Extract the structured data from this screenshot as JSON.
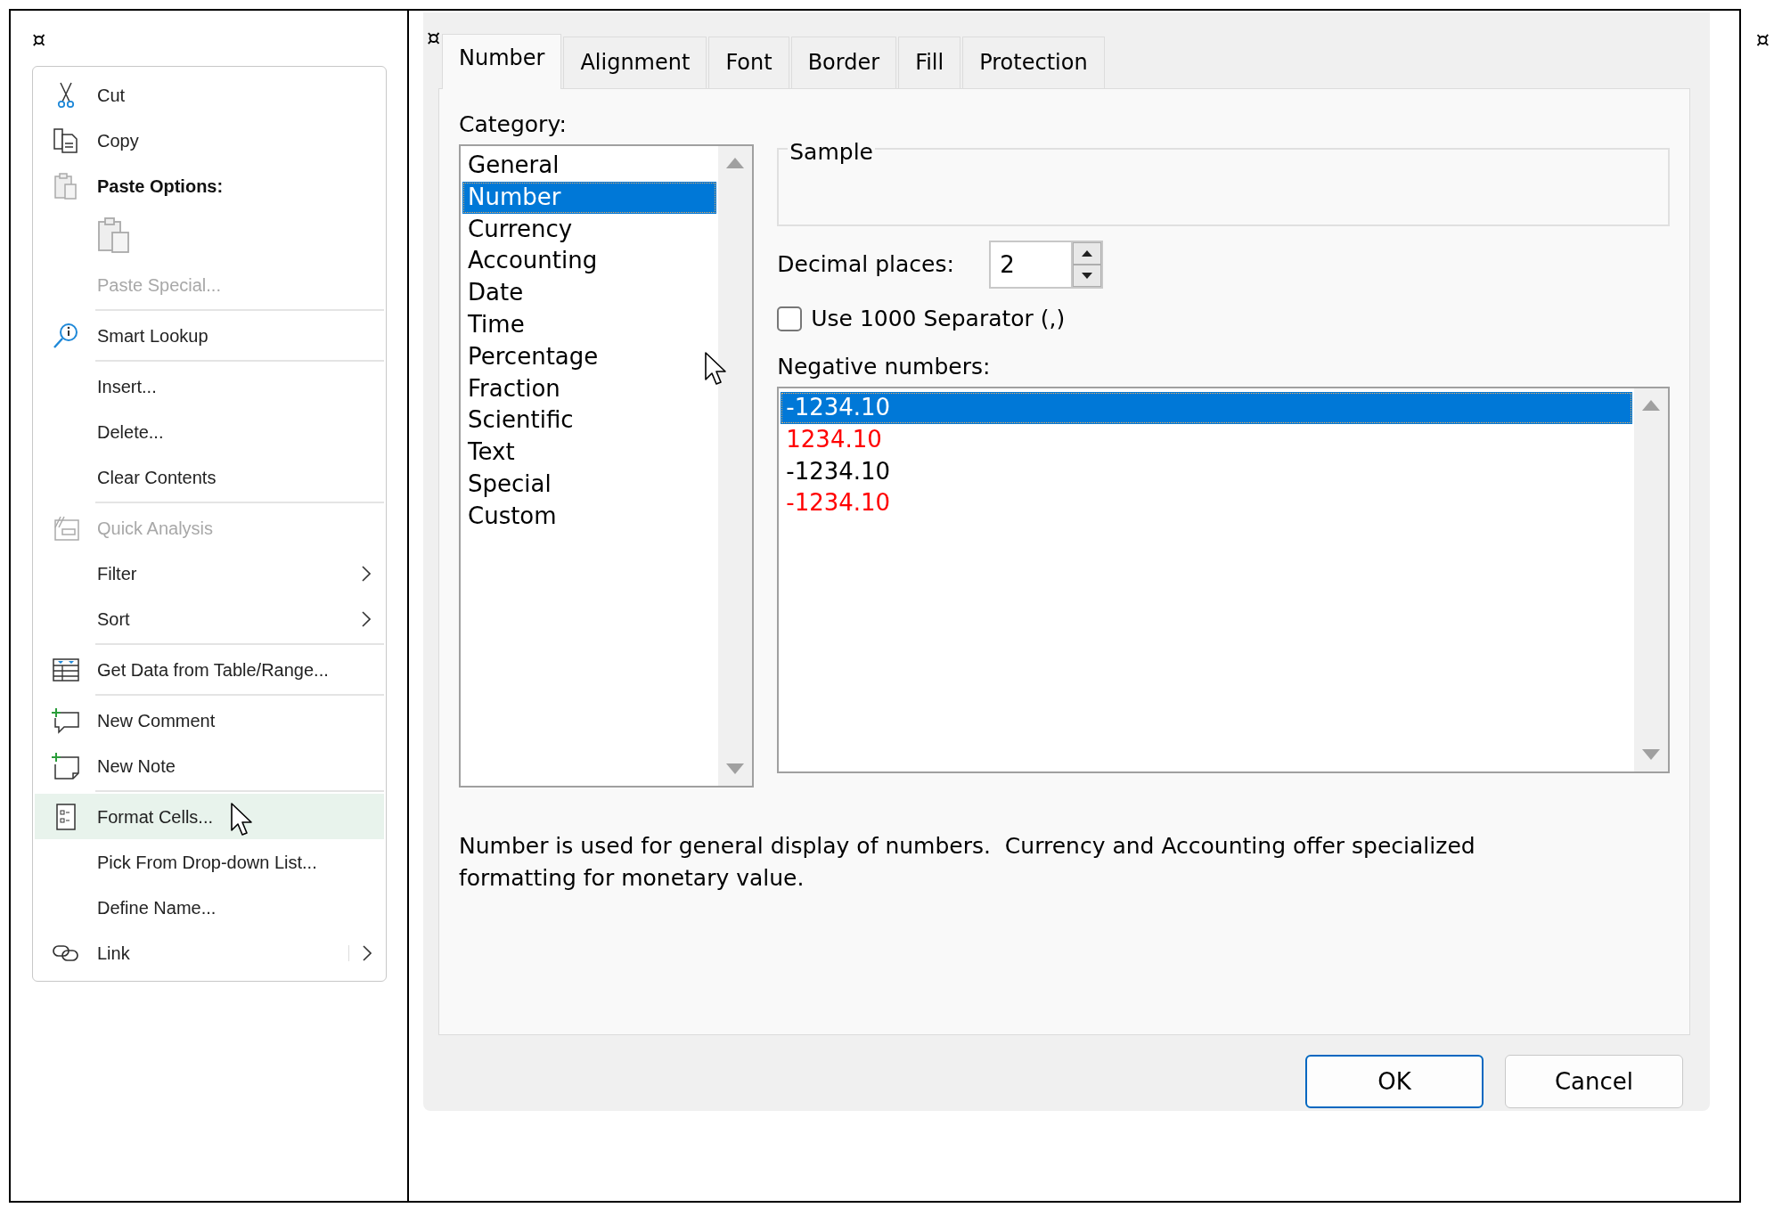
{
  "corner_marks": [
    "¤",
    "¤",
    "¤"
  ],
  "context_menu": {
    "items": [
      {
        "kind": "item",
        "label": "Cut",
        "disabled": false,
        "hovered": false,
        "submenu": false
      },
      {
        "kind": "item",
        "label": "Copy",
        "disabled": false,
        "hovered": false,
        "submenu": false
      },
      {
        "kind": "heading",
        "label": "Paste Options:",
        "disabled": false,
        "hovered": false,
        "submenu": false
      },
      {
        "kind": "paste-icons",
        "disabled": true
      },
      {
        "kind": "item",
        "label": "Paste Special...",
        "disabled": true,
        "hovered": false,
        "submenu": false
      },
      {
        "kind": "separator"
      },
      {
        "kind": "item",
        "label": "Smart Lookup",
        "disabled": false,
        "hovered": false,
        "submenu": false
      },
      {
        "kind": "separator"
      },
      {
        "kind": "item",
        "label": "Insert...",
        "disabled": false,
        "hovered": false,
        "submenu": false
      },
      {
        "kind": "item",
        "label": "Delete...",
        "disabled": false,
        "hovered": false,
        "submenu": false
      },
      {
        "kind": "item",
        "label": "Clear Contents",
        "disabled": false,
        "hovered": false,
        "submenu": false
      },
      {
        "kind": "separator"
      },
      {
        "kind": "item",
        "label": "Quick Analysis",
        "disabled": true,
        "hovered": false,
        "submenu": false
      },
      {
        "kind": "item",
        "label": "Filter",
        "disabled": false,
        "hovered": false,
        "submenu": true
      },
      {
        "kind": "item",
        "label": "Sort",
        "disabled": false,
        "hovered": false,
        "submenu": true
      },
      {
        "kind": "separator"
      },
      {
        "kind": "item",
        "label": "Get Data from Table/Range...",
        "disabled": false,
        "hovered": false,
        "submenu": false
      },
      {
        "kind": "separator"
      },
      {
        "kind": "item",
        "label": "New Comment",
        "disabled": false,
        "hovered": false,
        "submenu": false
      },
      {
        "kind": "item",
        "label": "New Note",
        "disabled": false,
        "hovered": false,
        "submenu": false
      },
      {
        "kind": "separator"
      },
      {
        "kind": "item",
        "label": "Format Cells...",
        "disabled": false,
        "hovered": true,
        "submenu": false
      },
      {
        "kind": "item",
        "label": "Pick From Drop-down List...",
        "disabled": false,
        "hovered": false,
        "submenu": false
      },
      {
        "kind": "item",
        "label": "Define Name...",
        "disabled": false,
        "hovered": false,
        "submenu": false
      },
      {
        "kind": "item",
        "label": "Link",
        "disabled": false,
        "hovered": false,
        "submenu": true
      }
    ]
  },
  "dialog": {
    "tabs": [
      {
        "label": "Number",
        "selected": true
      },
      {
        "label": "Alignment",
        "selected": false
      },
      {
        "label": "Font",
        "selected": false
      },
      {
        "label": "Border",
        "selected": false
      },
      {
        "label": "Fill",
        "selected": false
      },
      {
        "label": "Protection",
        "selected": false
      }
    ],
    "category": {
      "label": "Category:",
      "items": [
        {
          "label": "General",
          "selected": false
        },
        {
          "label": "Number",
          "selected": true
        },
        {
          "label": "Currency",
          "selected": false
        },
        {
          "label": "Accounting",
          "selected": false
        },
        {
          "label": "Date",
          "selected": false
        },
        {
          "label": "Time",
          "selected": false
        },
        {
          "label": "Percentage",
          "selected": false
        },
        {
          "label": "Fraction",
          "selected": false
        },
        {
          "label": "Scientific",
          "selected": false
        },
        {
          "label": "Text",
          "selected": false
        },
        {
          "label": "Special",
          "selected": false
        },
        {
          "label": "Custom",
          "selected": false
        }
      ]
    },
    "sample": {
      "label": "Sample"
    },
    "decimal_places": {
      "label": "Decimal places:",
      "value": "2"
    },
    "separator_checkbox": {
      "label": "Use 1000 Separator (,)",
      "checked": false
    },
    "negative_numbers": {
      "label": "Negative numbers:",
      "items": [
        {
          "label": "-1234.10",
          "selected": true
        },
        {
          "label": "1234.10",
          "selected": false,
          "color": "#ff0000"
        },
        {
          "label": "-1234.10",
          "selected": false,
          "color": "#000000"
        },
        {
          "label": "-1234.10",
          "selected": false,
          "color": "#ff0000"
        }
      ]
    },
    "description": "Number is used for general display of numbers.  Currency and Accounting offer specialized formatting for monetary value.",
    "buttons": [
      {
        "label": "OK",
        "default": true
      },
      {
        "label": "Cancel",
        "default": false
      }
    ]
  }
}
